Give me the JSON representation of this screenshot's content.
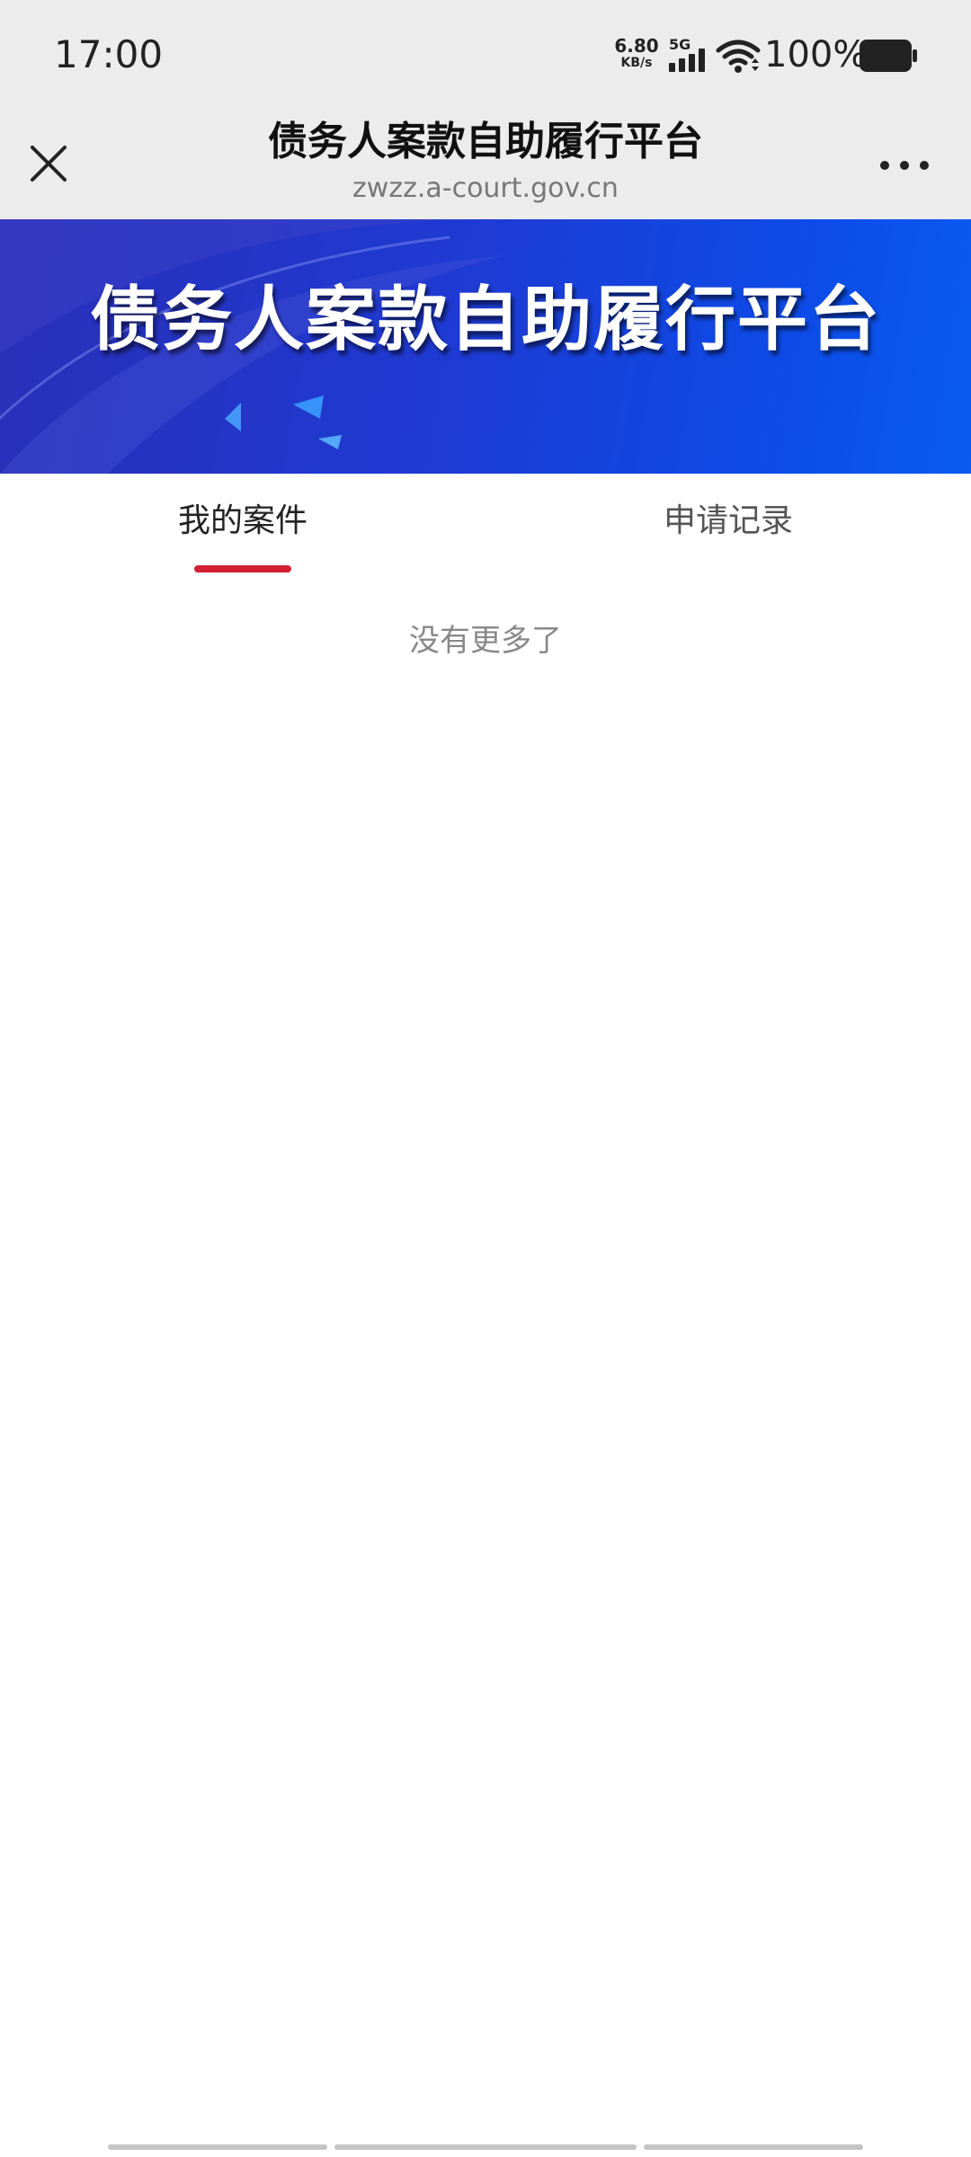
{
  "status_bar": {
    "time": "17:00",
    "net_speed_value": "6.80",
    "net_speed_unit": "KB/s",
    "network_type": "5G",
    "battery_percent": "100%",
    "icons": [
      "signal-icon",
      "wifi-icon",
      "battery-icon"
    ]
  },
  "title_bar": {
    "title": "债务人案款自助履行平台",
    "url": "zwzz.a-court.gov.cn",
    "close_icon": "close-icon",
    "more_icon": "more-icon"
  },
  "banner": {
    "title": "债务人案款自助履行平台"
  },
  "tabs": [
    {
      "label": "我的案件",
      "active": true
    },
    {
      "label": "申请记录",
      "active": false
    }
  ],
  "content": {
    "empty_message": "没有更多了"
  },
  "colors": {
    "chrome_bg": "#ececec",
    "banner_blue": "#1f3ad2",
    "tab_indicator": "#d21f33",
    "muted_text": "#888888"
  }
}
